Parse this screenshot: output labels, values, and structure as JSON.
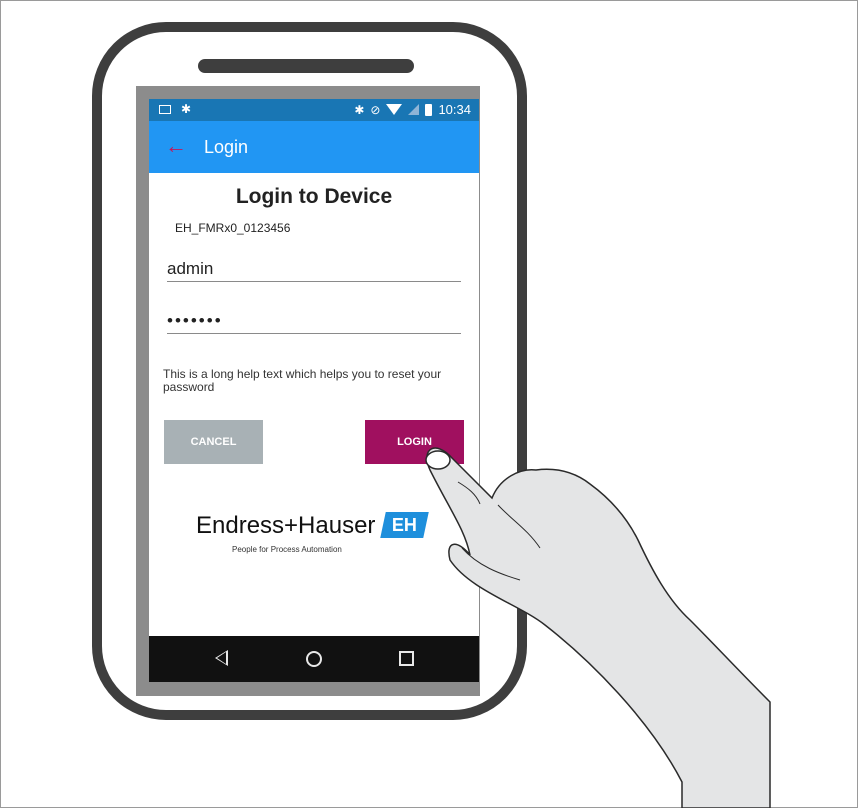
{
  "status_bar": {
    "time": "10:34"
  },
  "app_bar": {
    "title": "Login"
  },
  "form": {
    "heading": "Login to Device",
    "device_name": "EH_FMRx0_0123456",
    "username_value": "admin",
    "password_value": "•••••••",
    "help_text": "This is a long help text which helps you to reset your password",
    "cancel_label": "CANCEL",
    "login_label": "LOGIN"
  },
  "logo": {
    "name": "Endress+Hauser",
    "mark": "EH",
    "tagline": "People for Process Automation"
  },
  "nav_bar": {
    "icons": [
      "back-icon",
      "home-icon",
      "recents-icon"
    ]
  },
  "colors": {
    "status_bar": "#1976b4",
    "app_bar": "#2196f3",
    "login_button": "#a0105f",
    "cancel_button": "#a8b1b5",
    "logo_box": "#1e8fdc"
  }
}
